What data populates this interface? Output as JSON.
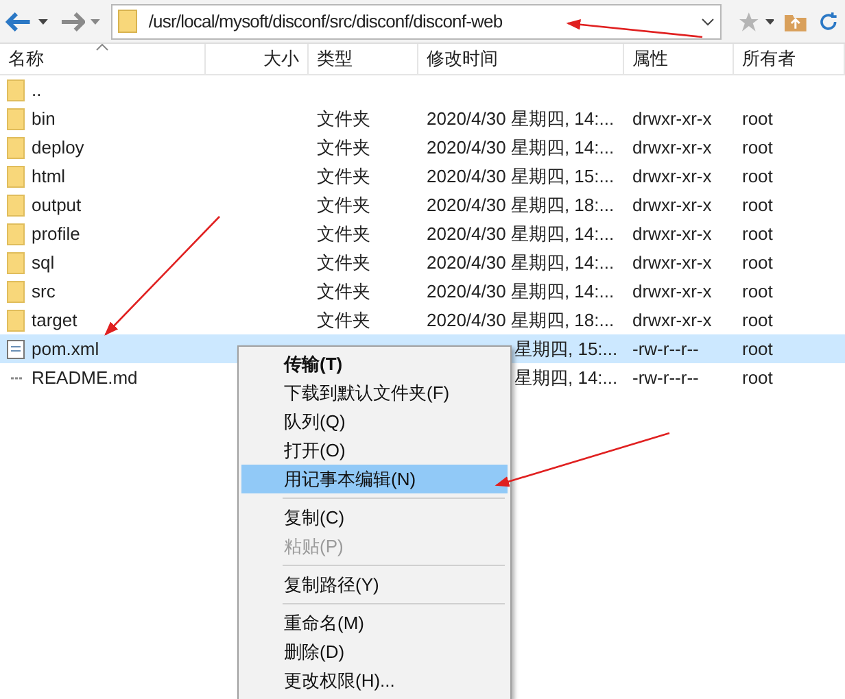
{
  "toolbar": {
    "address": "/usr/local/mysoft/disconf/src/disconf/disconf-web"
  },
  "columns": [
    {
      "label": "名称",
      "sorted": true
    },
    {
      "label": "大小",
      "sorted": false
    },
    {
      "label": "类型",
      "sorted": false
    },
    {
      "label": "修改时间",
      "sorted": false
    },
    {
      "label": "属性",
      "sorted": false
    },
    {
      "label": "所有者",
      "sorted": false
    }
  ],
  "rows": [
    {
      "kind": "parent",
      "name": "..",
      "selected": false
    },
    {
      "kind": "folder",
      "name": "bin",
      "type": "文件夹",
      "modified": "2020/4/30 星期四, 14:...",
      "attributes": "drwxr-xr-x",
      "owner": "root",
      "selected": false
    },
    {
      "kind": "folder",
      "name": "deploy",
      "type": "文件夹",
      "modified": "2020/4/30 星期四, 14:...",
      "attributes": "drwxr-xr-x",
      "owner": "root",
      "selected": false
    },
    {
      "kind": "folder",
      "name": "html",
      "type": "文件夹",
      "modified": "2020/4/30 星期四, 15:...",
      "attributes": "drwxr-xr-x",
      "owner": "root",
      "selected": false
    },
    {
      "kind": "folder",
      "name": "output",
      "type": "文件夹",
      "modified": "2020/4/30 星期四, 18:...",
      "attributes": "drwxr-xr-x",
      "owner": "root",
      "selected": false
    },
    {
      "kind": "folder",
      "name": "profile",
      "type": "文件夹",
      "modified": "2020/4/30 星期四, 14:...",
      "attributes": "drwxr-xr-x",
      "owner": "root",
      "selected": false
    },
    {
      "kind": "folder",
      "name": "sql",
      "type": "文件夹",
      "modified": "2020/4/30 星期四, 14:...",
      "attributes": "drwxr-xr-x",
      "owner": "root",
      "selected": false
    },
    {
      "kind": "folder",
      "name": "src",
      "type": "文件夹",
      "modified": "2020/4/30 星期四, 14:...",
      "attributes": "drwxr-xr-x",
      "owner": "root",
      "selected": false
    },
    {
      "kind": "folder",
      "name": "target",
      "type": "文件夹",
      "modified": "2020/4/30 星期四, 18:...",
      "attributes": "drwxr-xr-x",
      "owner": "root",
      "selected": false
    },
    {
      "kind": "xml",
      "name": "pom.xml",
      "modified": "星期四, 15:...",
      "attributes": "-rw-r--r--",
      "owner": "root",
      "selected": true
    },
    {
      "kind": "text",
      "name": "README.md",
      "modified": "星期四, 14:...",
      "attributes": "-rw-r--r--",
      "owner": "root",
      "selected": false
    }
  ],
  "context_menu": [
    {
      "kind": "item",
      "label": "传输(T)",
      "default": true,
      "selected": false,
      "disabled": false
    },
    {
      "kind": "item",
      "label": "下载到默认文件夹(F)",
      "default": false,
      "selected": false,
      "disabled": false
    },
    {
      "kind": "item",
      "label": "队列(Q)",
      "default": false,
      "selected": false,
      "disabled": false
    },
    {
      "kind": "item",
      "label": "打开(O)",
      "default": false,
      "selected": false,
      "disabled": false
    },
    {
      "kind": "item",
      "label": "用记事本编辑(N)",
      "default": false,
      "selected": true,
      "disabled": false
    },
    {
      "kind": "separator"
    },
    {
      "kind": "item",
      "label": "复制(C)",
      "default": false,
      "selected": false,
      "disabled": false
    },
    {
      "kind": "item",
      "label": "粘贴(P)",
      "default": false,
      "selected": false,
      "disabled": true
    },
    {
      "kind": "separator"
    },
    {
      "kind": "item",
      "label": "复制路径(Y)",
      "default": false,
      "selected": false,
      "disabled": false
    },
    {
      "kind": "separator"
    },
    {
      "kind": "item",
      "label": "重命名(M)",
      "default": false,
      "selected": false,
      "disabled": false
    },
    {
      "kind": "item",
      "label": "删除(D)",
      "default": false,
      "selected": false,
      "disabled": false
    },
    {
      "kind": "item",
      "label": "更改权限(H)...",
      "default": false,
      "selected": false,
      "disabled": false
    }
  ]
}
